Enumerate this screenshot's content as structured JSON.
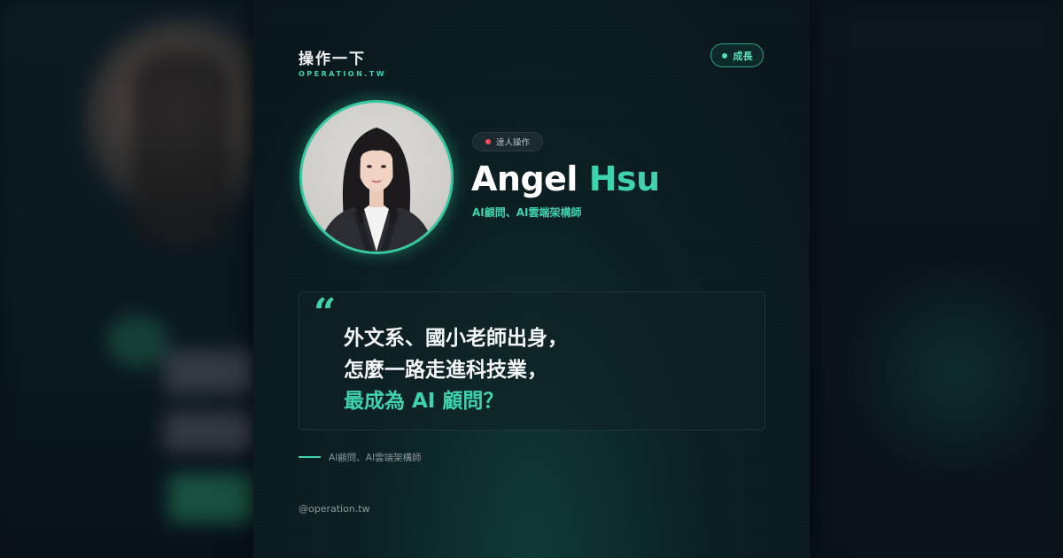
{
  "brand": {
    "title": "操作一下",
    "subtitle": "OPERATION.TW"
  },
  "category_tag": {
    "label": "成長",
    "color": "#3fd3ad"
  },
  "profile": {
    "role_badge": "達人操作",
    "role_dot_color": "#ff4d5a",
    "name_first": "Angel",
    "name_last": "Hsu",
    "title": "AI顧問、AI雲端架構師",
    "avatar_icon": "portrait-photo"
  },
  "quote": {
    "mark": "“",
    "line1": "外文系、國小老師出身，",
    "line2": "怎麼一路走進科技業，",
    "line3": "最成為 AI 顧問？"
  },
  "footer": {
    "caption": "AI顧問、AI雲端架構師",
    "handle": "@operation.tw"
  },
  "colors": {
    "accent": "#3fd3ad",
    "background": "#0a161c"
  }
}
